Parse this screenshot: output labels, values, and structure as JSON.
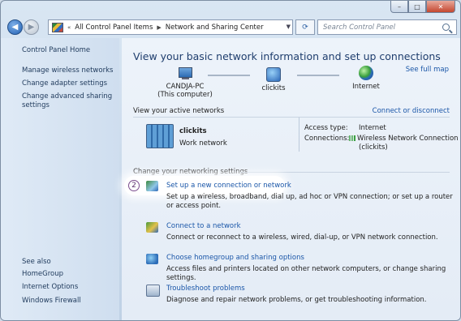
{
  "window": {
    "title": "Network and Sharing Center"
  },
  "caption": {
    "minimize": "–",
    "maximize": "□",
    "close": "✕"
  },
  "address": {
    "crumbs": [
      "All Control Panel Items",
      "Network and Sharing Center"
    ],
    "history_glyph": "«"
  },
  "search": {
    "placeholder": "Search Control Panel"
  },
  "sidebar": {
    "home": "Control Panel Home",
    "links": [
      "Manage wireless networks",
      "Change adapter settings",
      "Change advanced sharing settings"
    ],
    "see_also_label": "See also",
    "see_also": [
      "HomeGroup",
      "Internet Options",
      "Windows Firewall"
    ]
  },
  "main": {
    "title": "View your basic network information and set up connections",
    "see_full_map": "See full map",
    "map": {
      "computer_name": "CANDJA-PC",
      "computer_sub": "(This computer)",
      "network": "clickits",
      "internet": "Internet"
    },
    "active_networks": {
      "header": "View your active networks",
      "connect_disconnect": "Connect or disconnect",
      "name": "clickits",
      "type": "Work network",
      "access_type_label": "Access type:",
      "access_type_value": "Internet",
      "connections_label": "Connections:",
      "connection_value": "Wireless Network Connection",
      "connection_sub": "(clickits)"
    },
    "settings_header": "Change your networking settings",
    "step_number": "2",
    "tasks": [
      {
        "title": "Set up a new connection or network",
        "desc": "Set up a wireless, broadband, dial up, ad hoc or VPN connection; or set up a router or access point."
      },
      {
        "title": "Connect to a network",
        "desc": "Connect or reconnect to a wireless, wired, dial-up, or VPN network connection."
      },
      {
        "title": "Choose homegroup and sharing options",
        "desc": "Access files and printers located on other network computers, or change sharing settings."
      },
      {
        "title": "Troubleshoot problems",
        "desc": "Diagnose and repair network problems, or get troubleshooting information."
      }
    ]
  }
}
